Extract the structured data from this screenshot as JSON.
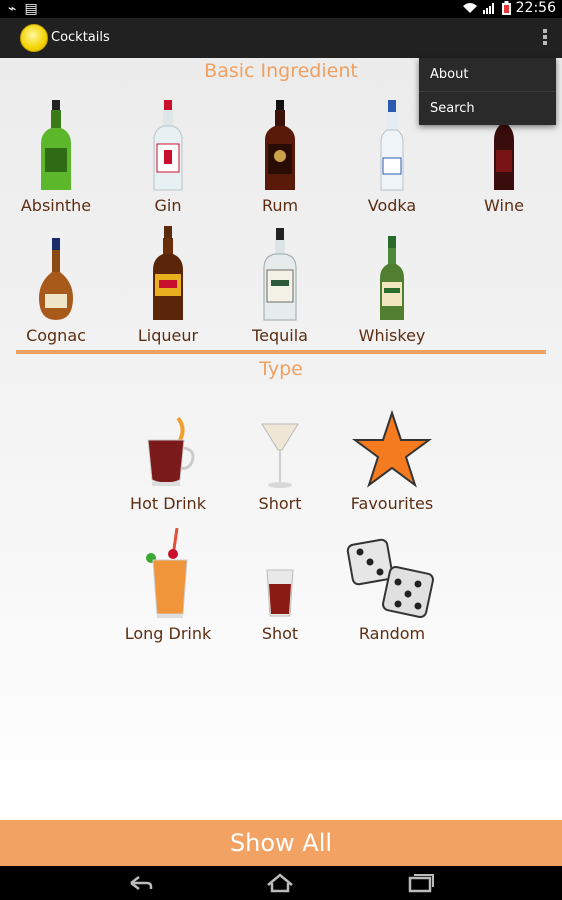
{
  "status": {
    "time": "22:56"
  },
  "app": {
    "title": "Cocktails"
  },
  "menu": {
    "items": [
      {
        "label": "About"
      },
      {
        "label": "Search"
      }
    ]
  },
  "ingredients": {
    "title": "Basic Ingredient",
    "items": [
      {
        "label": "Absinthe"
      },
      {
        "label": "Gin"
      },
      {
        "label": "Rum"
      },
      {
        "label": "Vodka"
      },
      {
        "label": "Wine"
      },
      {
        "label": "Cognac"
      },
      {
        "label": "Liqueur"
      },
      {
        "label": "Tequila"
      },
      {
        "label": "Whiskey"
      }
    ]
  },
  "types": {
    "title": "Type",
    "items": [
      {
        "label": "Hot Drink"
      },
      {
        "label": "Short"
      },
      {
        "label": "Favourites"
      },
      {
        "label": "Long Drink"
      },
      {
        "label": "Shot"
      },
      {
        "label": "Random"
      }
    ]
  },
  "footer": {
    "show_all_label": "Show All"
  }
}
